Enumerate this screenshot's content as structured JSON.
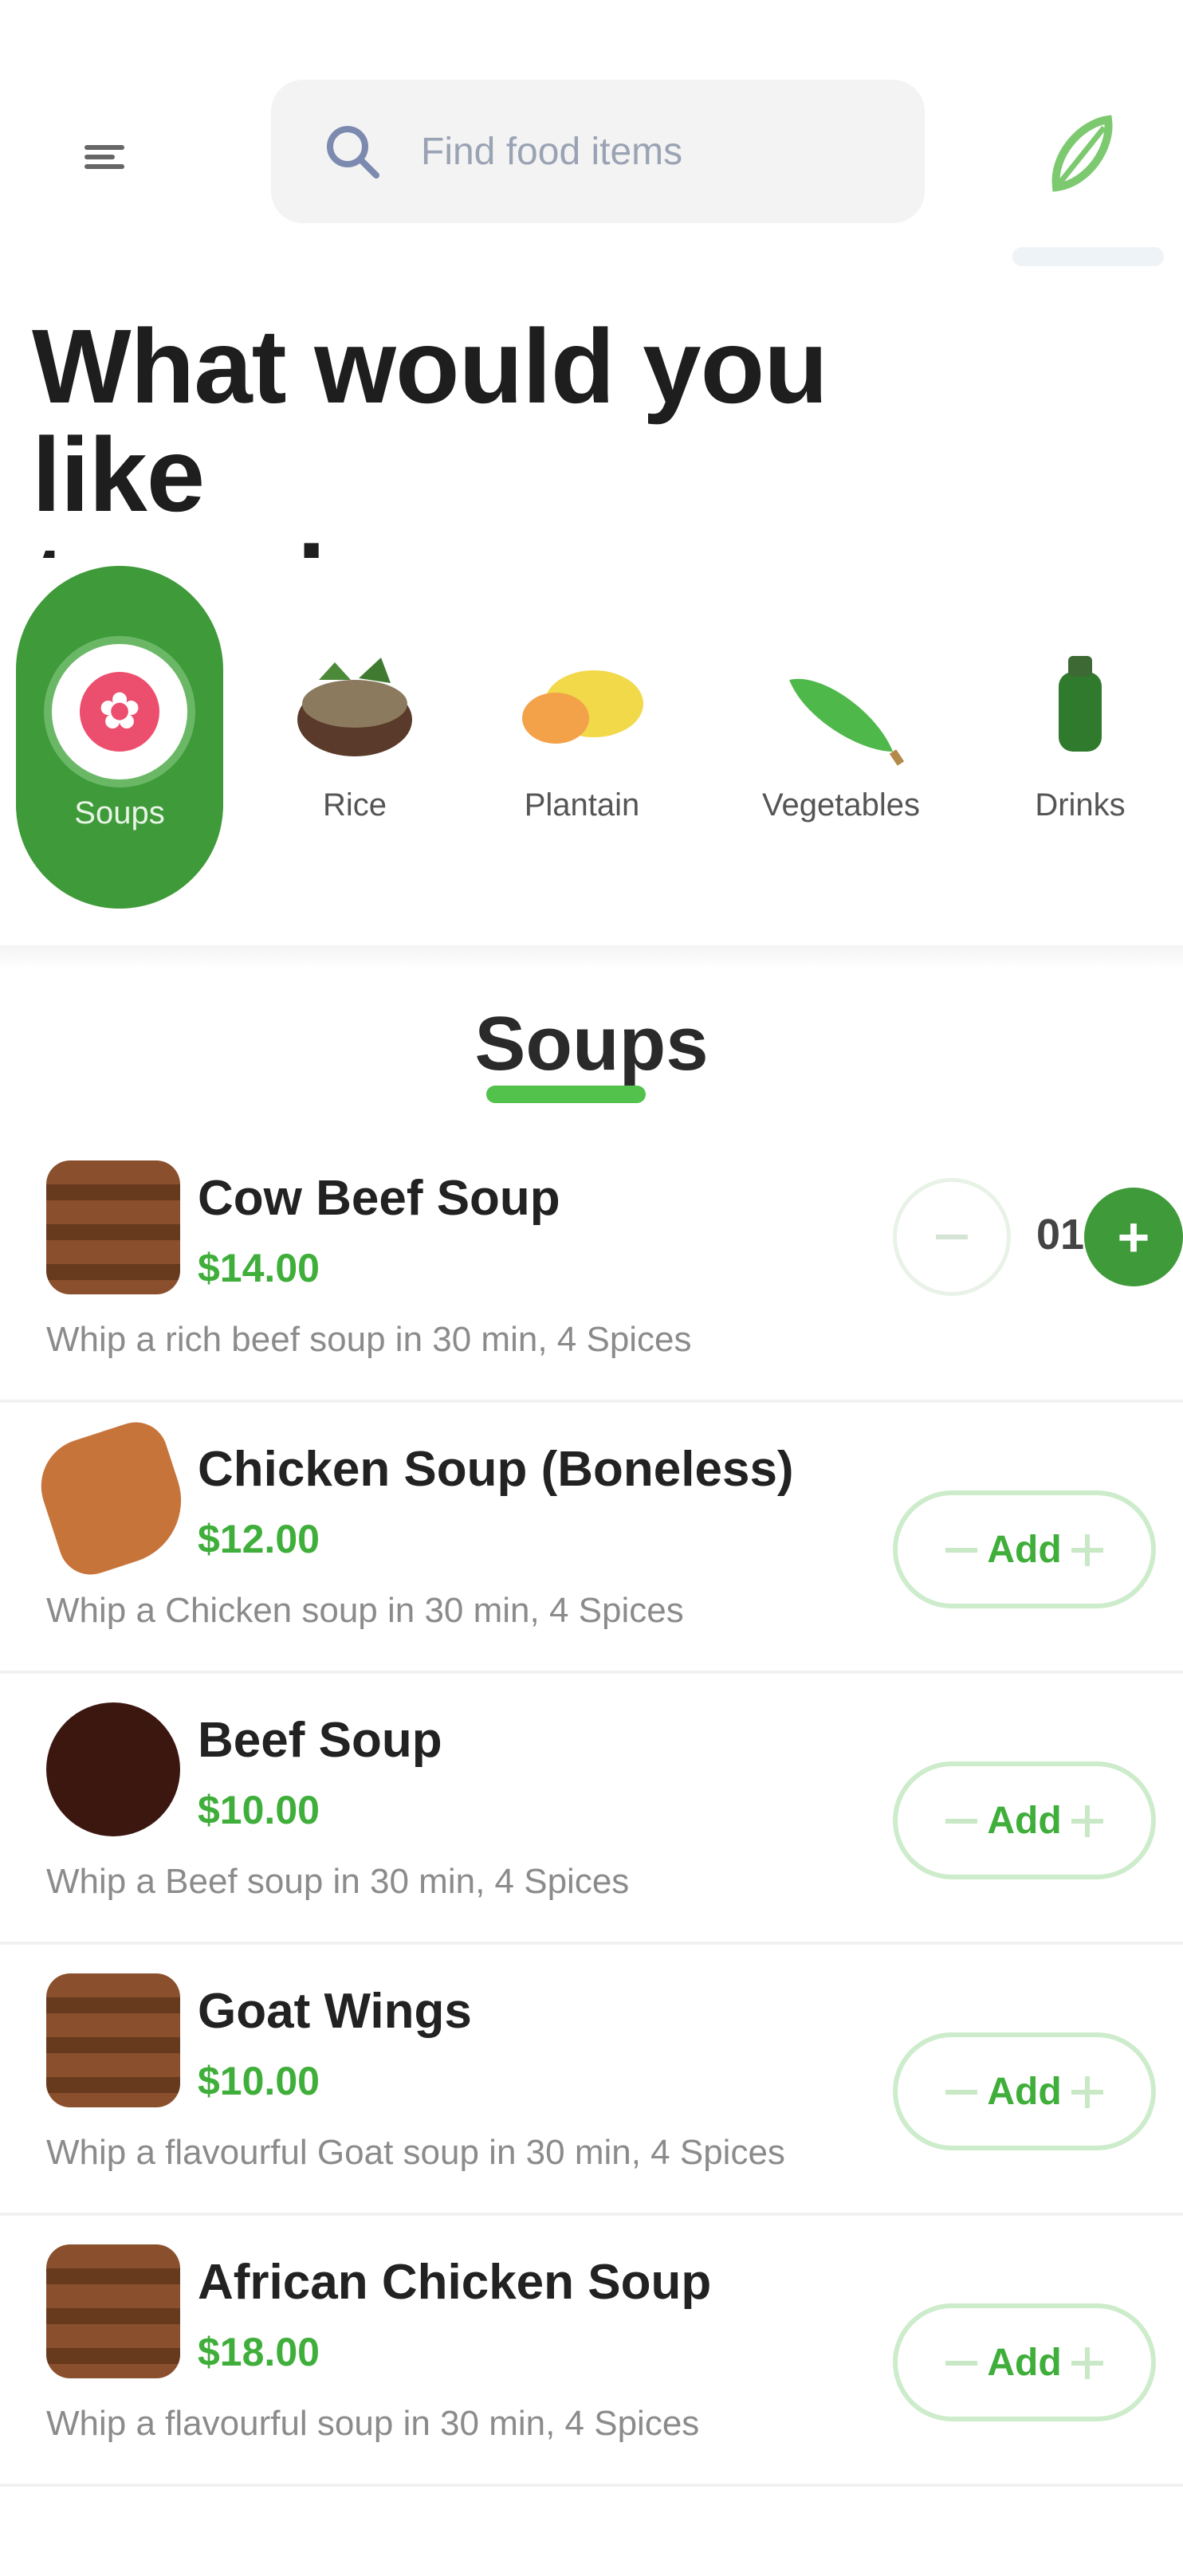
{
  "search": {
    "placeholder": "Find food items"
  },
  "heading": {
    "line1": "What would you like",
    "line2": "to order"
  },
  "categories": [
    {
      "label": "Soups",
      "icon": "soup-bowl-icon",
      "active": true
    },
    {
      "label": "Rice",
      "icon": "rice-bowl-icon"
    },
    {
      "label": "Plantain",
      "icon": "plantain-icon"
    },
    {
      "label": "Vegetables",
      "icon": "green-vegetable-icon"
    },
    {
      "label": "Drinks",
      "icon": "drink-bottle-icon"
    }
  ],
  "section": {
    "title": "Soups"
  },
  "items": [
    {
      "name": "Cow Beef Soup",
      "price": "$14.00",
      "description": "Whip a rich beef soup in 30 min, 4 Spices",
      "quantity": "01",
      "action": "stepper"
    },
    {
      "name": "Chicken Soup (Boneless)",
      "price": "$12.00",
      "description": "Whip a Chicken soup in 30 min, 4 Spices",
      "add_label": "Add",
      "action": "add"
    },
    {
      "name": "Beef Soup",
      "price": "$10.00",
      "description": "Whip a Beef soup in 30 min, 4 Spices",
      "add_label": "Add",
      "action": "add"
    },
    {
      "name": "Goat Wings",
      "price": "$10.00",
      "description": "Whip a flavourful Goat soup in 30 min, 4 Spices",
      "add_label": "Add",
      "action": "add"
    },
    {
      "name": "African Chicken Soup",
      "price": "$18.00",
      "description": "Whip a flavourful soup in 30 min, 4 Spices",
      "add_label": "Add",
      "action": "add"
    }
  ],
  "colors": {
    "accent": "#3f9a3a",
    "price": "#3fae3a",
    "active_category": "#3f9a3a"
  }
}
